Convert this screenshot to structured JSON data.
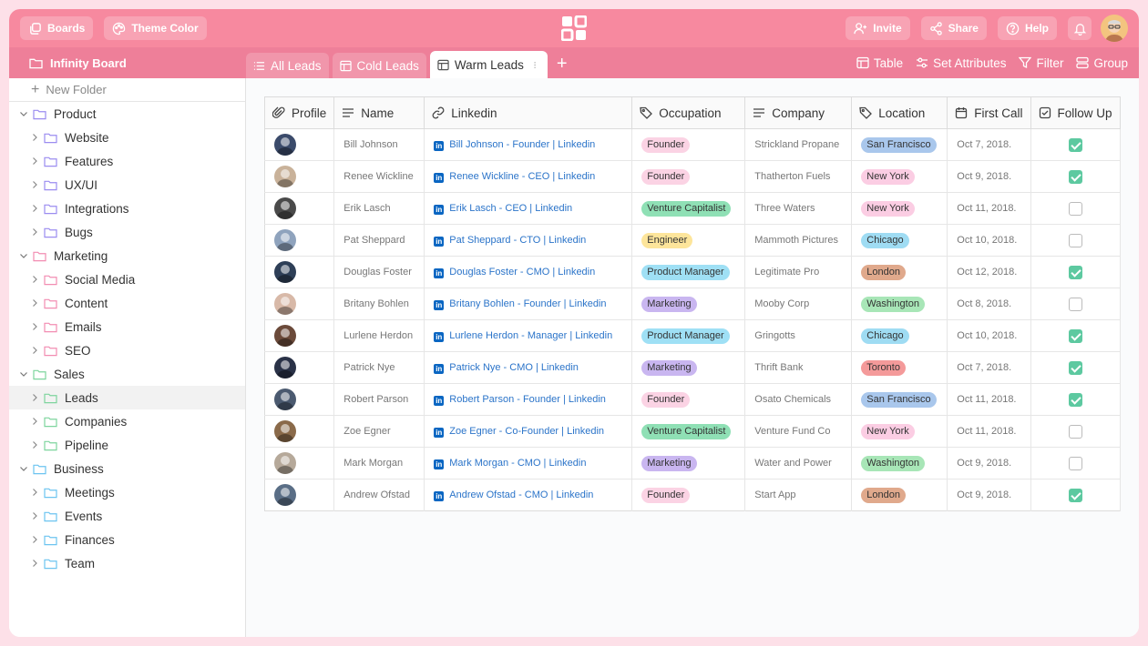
{
  "topbar": {
    "boards_label": "Boards",
    "theme_label": "Theme Color",
    "invite_label": "Invite",
    "share_label": "Share",
    "help_label": "Help"
  },
  "subbar": {
    "board_title": "Infinity Board",
    "tabs": [
      {
        "label": "All Leads",
        "icon": "list-icon"
      },
      {
        "label": "Cold Leads",
        "icon": "table-icon"
      },
      {
        "label": "Warm Leads",
        "icon": "table-icon"
      }
    ],
    "actions": {
      "table": "Table",
      "attributes": "Set Attributes",
      "filter": "Filter",
      "group": "Group"
    }
  },
  "sidebar": {
    "new_folder": "New Folder",
    "groups": [
      {
        "label": "Product",
        "color": "#9b8cf0",
        "children": [
          "Website",
          "Features",
          "UX/UI",
          "Integrations",
          "Bugs"
        ]
      },
      {
        "label": "Marketing",
        "color": "#f28db2",
        "children": [
          "Social Media",
          "Content",
          "Emails",
          "SEO"
        ]
      },
      {
        "label": "Sales",
        "color": "#7ed59e",
        "children": [
          "Leads",
          "Companies",
          "Pipeline"
        ]
      },
      {
        "label": "Business",
        "color": "#6cc4f0",
        "children": [
          "Meetings",
          "Events",
          "Finances",
          "Team"
        ]
      }
    ],
    "selected": "Leads"
  },
  "table": {
    "headers": [
      "Profile",
      "Name",
      "Linkedin",
      "Occupation",
      "Company",
      "Location",
      "First Call",
      "Follow Up"
    ],
    "rows": [
      {
        "name": "Bill Johnson",
        "linkedin": "Bill Johnson - Founder | Linkedin",
        "occupation": "Founder",
        "company": "Strickland Propane",
        "location": "San Francisco",
        "first_call": "Oct 7, 2018.",
        "follow_up": true
      },
      {
        "name": "Renee Wickline",
        "linkedin": "Renee Wickline - CEO | Linkedin",
        "occupation": "Founder",
        "company": "Thatherton Fuels",
        "location": "New York",
        "first_call": "Oct 9, 2018.",
        "follow_up": true
      },
      {
        "name": "Erik Lasch",
        "linkedin": "Erik Lasch - CEO | Linkedin",
        "occupation": "Venture Capitalist",
        "company": "Three Waters",
        "location": "New York",
        "first_call": "Oct 11, 2018.",
        "follow_up": false
      },
      {
        "name": "Pat Sheppard",
        "linkedin": "Pat Sheppard - CTO | Linkedin",
        "occupation": "Engineer",
        "company": "Mammoth Pictures",
        "location": "Chicago",
        "first_call": "Oct 10, 2018.",
        "follow_up": false
      },
      {
        "name": "Douglas Foster",
        "linkedin": "Douglas Foster - CMO | Linkedin",
        "occupation": "Product Manager",
        "company": "Legitimate Pro",
        "location": "London",
        "first_call": "Oct 12, 2018.",
        "follow_up": true
      },
      {
        "name": "Britany Bohlen",
        "linkedin": "Britany Bohlen - Founder | Linkedin",
        "occupation": "Marketing",
        "company": "Mooby Corp",
        "location": "Washington",
        "first_call": "Oct 8, 2018.",
        "follow_up": false
      },
      {
        "name": "Lurlene Herdon",
        "linkedin": "Lurlene Herdon - Manager | Linkedin",
        "occupation": "Product Manager",
        "company": "Gringotts",
        "location": "Chicago",
        "first_call": "Oct 10, 2018.",
        "follow_up": true
      },
      {
        "name": "Patrick Nye",
        "linkedin": "Patrick Nye - CMO | Linkedin",
        "occupation": "Marketing",
        "company": "Thrift Bank",
        "location": "Toronto",
        "first_call": "Oct 7, 2018.",
        "follow_up": true
      },
      {
        "name": "Robert Parson",
        "linkedin": "Robert Parson - Founder | Linkedin",
        "occupation": "Founder",
        "company": "Osato Chemicals",
        "location": "San Francisco",
        "first_call": "Oct 11, 2018.",
        "follow_up": true
      },
      {
        "name": "Zoe Egner",
        "linkedin": "Zoe Egner - Co-Founder | Linkedin",
        "occupation": "Venture Capitalist",
        "company": "Venture Fund Co",
        "location": "New York",
        "first_call": "Oct 11, 2018.",
        "follow_up": false
      },
      {
        "name": "Mark Morgan",
        "linkedin": "Mark Morgan - CMO | Linkedin",
        "occupation": "Marketing",
        "company": "Water and Power",
        "location": "Washington",
        "first_call": "Oct 9, 2018.",
        "follow_up": false
      },
      {
        "name": "Andrew Ofstad",
        "linkedin": "Andrew Ofstad - CMO | Linkedin",
        "occupation": "Founder",
        "company": "Start App",
        "location": "London",
        "first_call": "Oct 9, 2018.",
        "follow_up": true
      }
    ]
  },
  "colors": {
    "brand": "#f7899f",
    "brand_dark": "#ee7f99",
    "occupation": {
      "Founder": "#fbd3e4",
      "Venture Capitalist": "#8fe0b5",
      "Engineer": "#fde59b",
      "Product Manager": "#9fe0f5",
      "Marketing": "#c9b6f0"
    },
    "location": {
      "San Francisco": "#a9c7ec",
      "New York": "#fbcde3",
      "Chicago": "#9fdcf3",
      "London": "#e0a98c",
      "Washington": "#a8e6b7",
      "Toronto": "#f49a9a"
    },
    "avatars": [
      "#3b4b6b",
      "#c9b29a",
      "#4a4a4a",
      "#8fa3bd",
      "#2e3f57",
      "#d8b9a8",
      "#6b4a3a",
      "#2a3247",
      "#4b5a70",
      "#8a6a4a",
      "#b6a99a",
      "#5a6e86"
    ]
  },
  "icons": {
    "boards": "boards-icon",
    "theme": "palette-icon",
    "invite": "add-user-icon",
    "share": "share-icon",
    "help": "help-icon",
    "bell": "bell-icon"
  }
}
